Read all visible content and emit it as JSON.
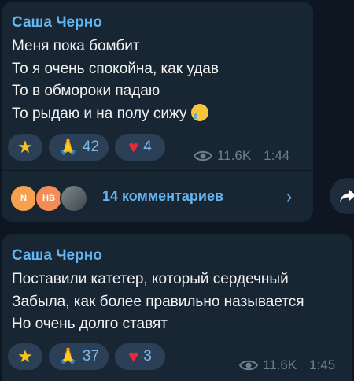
{
  "messages": [
    {
      "author": "Саша Черно",
      "lines": [
        "Меня пока бомбит",
        "То я очень спокойна, как удав",
        "То в обмороки падаю",
        "То рыдаю и на полу сижу"
      ],
      "reactions": [
        {
          "icon": "star",
          "count": ""
        },
        {
          "icon": "pray",
          "count": "42"
        },
        {
          "icon": "heart",
          "count": "4"
        }
      ],
      "views": "11.6K",
      "time": "1:44",
      "comments": {
        "avatars": [
          "N",
          "НВ"
        ],
        "label": "14 комментариев"
      }
    },
    {
      "author": "Саша Черно",
      "lines": [
        "Поставили катетер, который сердечный",
        "Забыла, как более правильно называется",
        "Но очень долго ставят"
      ],
      "reactions": [
        {
          "icon": "star",
          "count": ""
        },
        {
          "icon": "pray",
          "count": "37"
        },
        {
          "icon": "heart",
          "count": "3"
        }
      ],
      "views": "11.6K",
      "time": "1:45"
    }
  ],
  "colors": {
    "background": "#0e1621",
    "bubble": "#182533",
    "accent": "#64b5ef",
    "reaction_bg": "#2b3f57"
  }
}
